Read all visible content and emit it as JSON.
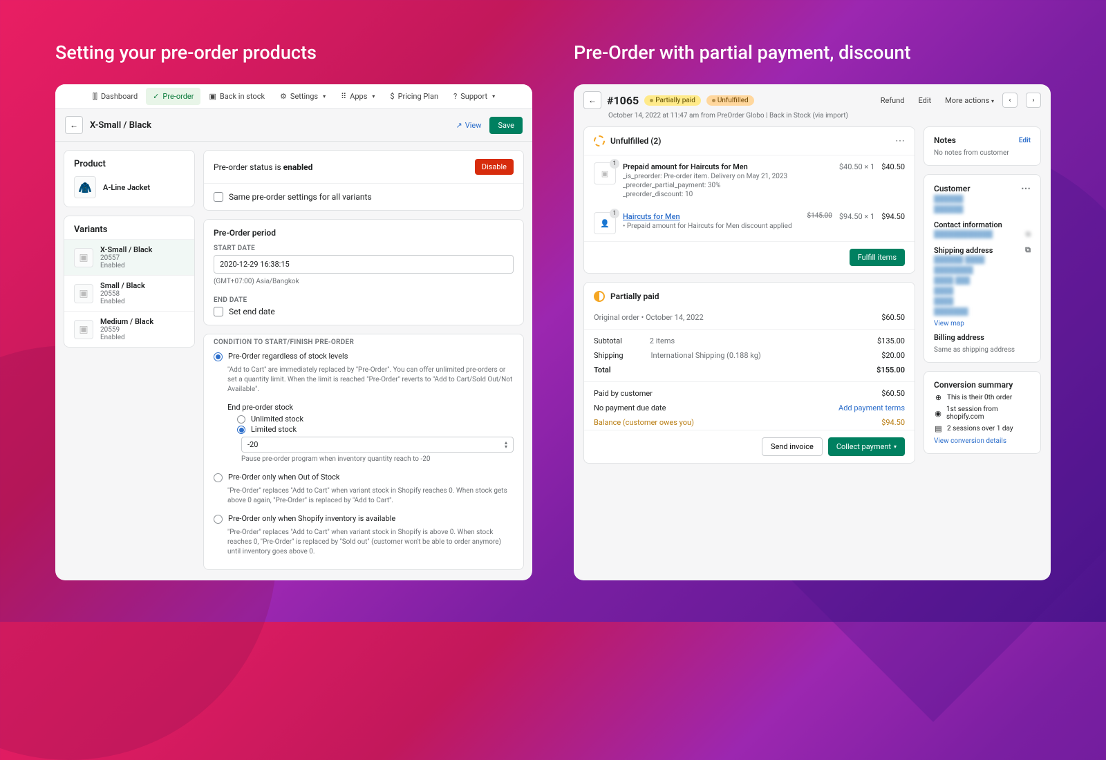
{
  "left": {
    "title": "Setting your pre-order products",
    "nav": [
      "Dashboard",
      "Pre-order",
      "Back in stock",
      "Settings",
      "Apps",
      "Pricing Plan",
      "Support"
    ],
    "variant_title": "X-Small / Black",
    "view": "View",
    "save": "Save",
    "product_h": "Product",
    "product_name": "A-Line Jacket",
    "variants_h": "Variants",
    "variants": [
      {
        "name": "X-Small / Black",
        "sku": "20557",
        "status": "Enabled"
      },
      {
        "name": "Small / Black",
        "sku": "20558",
        "status": "Enabled"
      },
      {
        "name": "Medium / Black",
        "sku": "20559",
        "status": "Enabled"
      }
    ],
    "status_pre": "Pre-order status is ",
    "status_val": "enabled",
    "disable": "Disable",
    "same_settings": "Same pre-order settings for all variants",
    "period_h": "Pre-Order period",
    "start_label": "START DATE",
    "start_val": "2020-12-29 16:38:15",
    "tz": "(GMT+07:00) Asia/Bangkok",
    "end_label": "END DATE",
    "set_end": "Set end date",
    "cond_label": "CONDITION TO START/FINISH PRE-ORDER",
    "opt1": "Pre-Order regardless of stock levels",
    "opt1_desc": "\"Add to Cart\" are immediately replaced by \"Pre-Order\". You can offer unlimited pre-orders or set a quantity limit. When the limit is reached \"Pre-Order\" reverts to \"Add to Cart/Sold Out/Not Available\".",
    "end_stock": "End pre-order stock",
    "unlimited": "Unlimited stock",
    "limited": "Limited stock",
    "limited_val": "-20",
    "limited_help": "Pause pre-order program when inventory quantity reach to -20",
    "opt2": "Pre-Order only when Out of Stock",
    "opt2_desc": "\"Pre-Order\" replaces \"Add to Cart\" when variant stock in Shopify reaches 0. When stock gets above 0 again, \"Pre-Order\" is replaced by \"Add to Cart\".",
    "opt3": "Pre-Order only when Shopify inventory is available",
    "opt3_desc": "\"Pre-Order\" replaces \"Add to Cart\" when variant stock in Shopify is above 0. When stock reaches 0, \"Pre-Order\" is replaced by \"Sold out\" (customer won't be able to order anymore) until inventory goes above 0."
  },
  "right": {
    "title": "Pre-Order with partial payment, discount",
    "order_num": "#1065",
    "badge1": "Partially paid",
    "badge2": "Unfulfilled",
    "refund": "Refund",
    "edit": "Edit",
    "more": "More actions",
    "subline": "October 14, 2022 at 11:47 am from PreOrder Globo | Back in Stock (via import)",
    "unful_h": "Unfulfilled (2)",
    "item1": {
      "name": "Prepaid amount for Haircuts for Men",
      "meta1": "_is_preorder: Pre-order item. Delivery on May 21, 2023",
      "meta2": "_preorder_partial_payment: 30%",
      "meta3": "_preorder_discount: 10",
      "price": "$40.50 × 1",
      "total": "$40.50"
    },
    "item2": {
      "name": "Haircuts for Men",
      "meta": "Prepaid amount for Haircuts for Men discount applied",
      "orig": "$145.00",
      "price": "$94.50 × 1",
      "total": "$94.50"
    },
    "fulfill_btn": "Fulfill items",
    "paid_h": "Partially paid",
    "paid_sub": "Original order • October 14, 2022",
    "paid_amt": "$60.50",
    "subtotal_l": "Subtotal",
    "subtotal_m": "2 items",
    "subtotal_v": "$135.00",
    "ship_l": "Shipping",
    "ship_m": "International Shipping (0.188 kg)",
    "ship_v": "$20.00",
    "total_l": "Total",
    "total_v": "$155.00",
    "paid_l": "Paid by customer",
    "paid_v": "$60.50",
    "due_l": "No payment due date",
    "add_terms": "Add payment terms",
    "bal_l": "Balance (customer owes you)",
    "bal_v": "$94.50",
    "send_inv": "Send invoice",
    "collect": "Collect payment",
    "notes_h": "Notes",
    "notes_edit": "Edit",
    "notes_sub": "No notes from customer",
    "cust_h": "Customer",
    "contact_h": "Contact information",
    "ship_addr_h": "Shipping address",
    "view_map": "View map",
    "bill_h": "Billing address",
    "bill_sub": "Same as shipping address",
    "conv_h": "Conversion summary",
    "conv1": "This is their 0th order",
    "conv2": "1st session from shopify.com",
    "conv3": "2 sessions over 1 day",
    "conv_link": "View conversion details"
  }
}
